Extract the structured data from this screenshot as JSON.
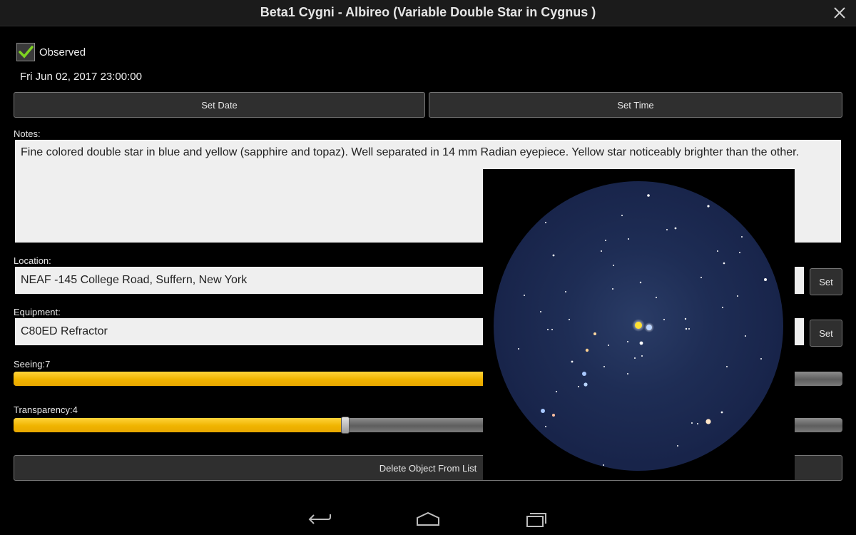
{
  "window": {
    "title": "Beta1 Cygni - Albireo (Variable Double Star in Cygnus )"
  },
  "observed": {
    "label": "Observed",
    "checked": true
  },
  "datetime": "Fri Jun 02, 2017  23:00:00",
  "buttons": {
    "set_date": "Set Date",
    "set_time": "Set Time",
    "set": "Set",
    "delete": "Delete Object From List"
  },
  "notes": {
    "label": "Notes:",
    "value": "Fine colored double star in blue and yellow (sapphire and topaz). Well separated in 14 mm Radian eyepiece. Yellow star noticeably brighter than the other."
  },
  "location": {
    "label": "Location:",
    "value": "NEAF -145 College Road, Suffern, New York"
  },
  "equipment": {
    "label": "Equipment:",
    "value": "C80ED Refractor"
  },
  "seeing": {
    "label": "Seeing:",
    "value": "7"
  },
  "transparency": {
    "label": "Transparency:",
    "value": "4",
    "fraction": 0.4
  },
  "icons": {
    "close": "close-icon",
    "checkmark": "checkmark-icon",
    "back": "back-icon",
    "home": "home-icon",
    "recents": "recents-icon"
  },
  "colors": {
    "accent": "#f5b800",
    "check": "#7ed321",
    "sky": "#1c2a4f"
  }
}
